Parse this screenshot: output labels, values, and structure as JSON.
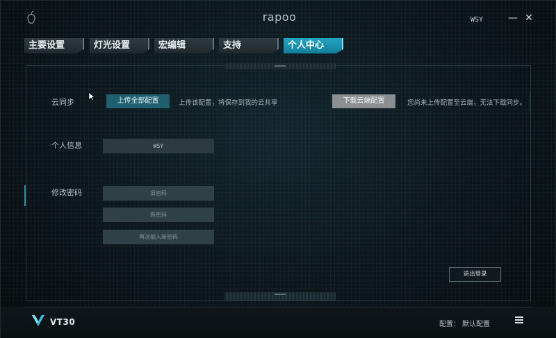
{
  "window": {
    "brand": "RAPOO",
    "user_name": "WSY",
    "minimize_label": "—",
    "close_label": "✕"
  },
  "tabs": [
    {
      "label": "主要设置",
      "active": false
    },
    {
      "label": "灯光设置",
      "active": false
    },
    {
      "label": "宏编辑",
      "active": false
    },
    {
      "label": "支持",
      "active": false
    },
    {
      "label": "个人中心",
      "active": true
    }
  ],
  "cloud_sync": {
    "label": "云同步",
    "upload_button": "上传全部配置",
    "upload_hint": "上传该配置，将保存到我的云共享",
    "download_button": "下载云端配置",
    "download_hint": "您尚未上传配置至云端，无法下载同步。"
  },
  "personal_info": {
    "label": "个人信息",
    "name_value": "WSY"
  },
  "change_password": {
    "label": "修改密码",
    "old_placeholder": "旧密码",
    "new_placeholder": "新密码",
    "confirm_placeholder": "再次输入新密码"
  },
  "logout_button": "退出登录",
  "footer": {
    "model": "VT30",
    "config_label": "配置：",
    "config_value": "默认配置"
  },
  "colors": {
    "accent": "#23a5c4",
    "primary_button": "#1f5f70",
    "disabled_button": "#8b8f91",
    "background": "#0c161b"
  },
  "icons": {
    "app": "apple-icon",
    "menu": "hamburger-icon",
    "logo": "vt-logo-icon"
  }
}
